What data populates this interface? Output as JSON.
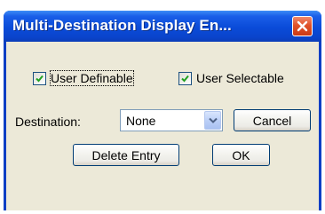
{
  "window": {
    "title": "Multi-Destination Display En..."
  },
  "options": {
    "user_definable": {
      "label": "User Definable",
      "checked": true
    },
    "user_selectable": {
      "label": "User Selectable",
      "checked": true
    }
  },
  "destination": {
    "label": "Destination:",
    "value": "None"
  },
  "buttons": {
    "cancel": "Cancel",
    "delete_entry": "Delete Entry",
    "ok": "OK"
  },
  "colors": {
    "titlebar": "#0a4bd8",
    "client_background": "#ece9d8",
    "close_button": "#e0522a",
    "check_mark": "#21a121"
  },
  "icons": {
    "close": "close-icon",
    "check": "check-icon",
    "dropdown": "chevron-down-icon"
  }
}
